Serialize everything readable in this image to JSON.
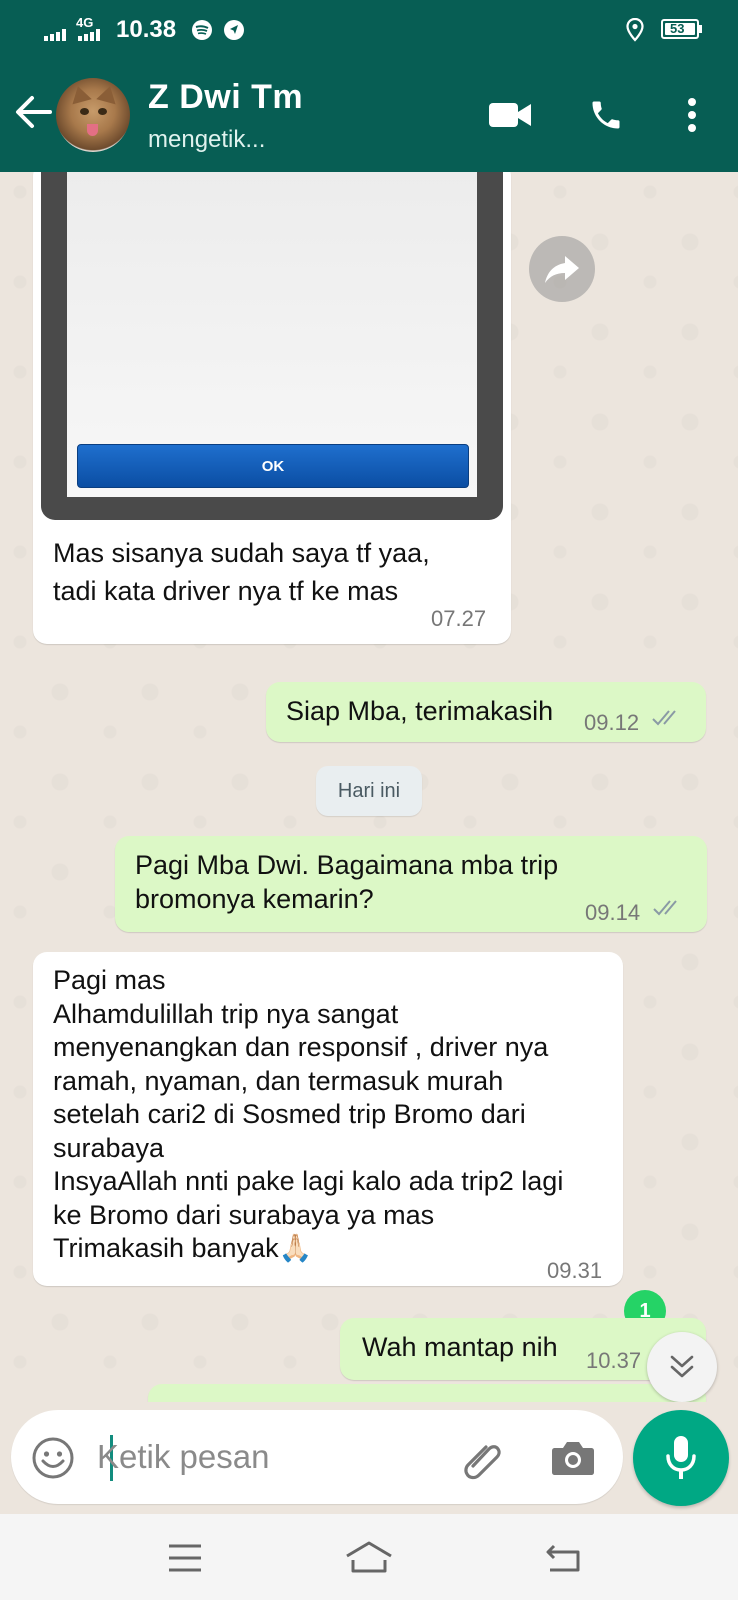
{
  "status_bar": {
    "network": "4G",
    "time": "10.38",
    "battery": "53"
  },
  "header": {
    "contact_name": "Z Dwi Tm",
    "contact_status": "mengetik..."
  },
  "messages": [
    {
      "direction": "in",
      "text_lines": [
        "Mas sisanya sudah saya tf yaa,",
        "tadi kata driver nya tf ke mas"
      ],
      "time": "07.27",
      "image_button_label": "OK"
    },
    {
      "direction": "out",
      "text_lines": [
        "Siap Mba, terimakasih"
      ],
      "time": "09.12"
    },
    {
      "direction": "out",
      "text_lines": [
        "Pagi Mba Dwi. Bagaimana mba trip",
        "bromonya kemarin?"
      ],
      "time": "09.14"
    },
    {
      "direction": "in",
      "text_lines": [
        "Pagi mas",
        "Alhamdulillah  trip nya sangat",
        "menyenangkan dan responsif , driver nya",
        "ramah, nyaman, dan termasuk murah",
        "setelah cari2 di Sosmed trip Bromo dari",
        "surabaya",
        "InsyaAllah nnti pake lagi kalo ada trip2 lagi",
        "ke Bromo dari surabaya ya mas",
        "Trimakasih banyak🙏🏻"
      ],
      "time": "09.31"
    },
    {
      "direction": "out",
      "text_lines": [
        "Wah mantap nih"
      ],
      "time": "10.37"
    }
  ],
  "date_divider": "Hari ini",
  "unread_count": "1",
  "input": {
    "placeholder": "Ketik pesan"
  },
  "colors": {
    "header": "#075e54",
    "outgoing": "#dcf8c6",
    "incoming": "#ffffff",
    "mic": "#00a884",
    "ticks": "#8a9aa5"
  }
}
